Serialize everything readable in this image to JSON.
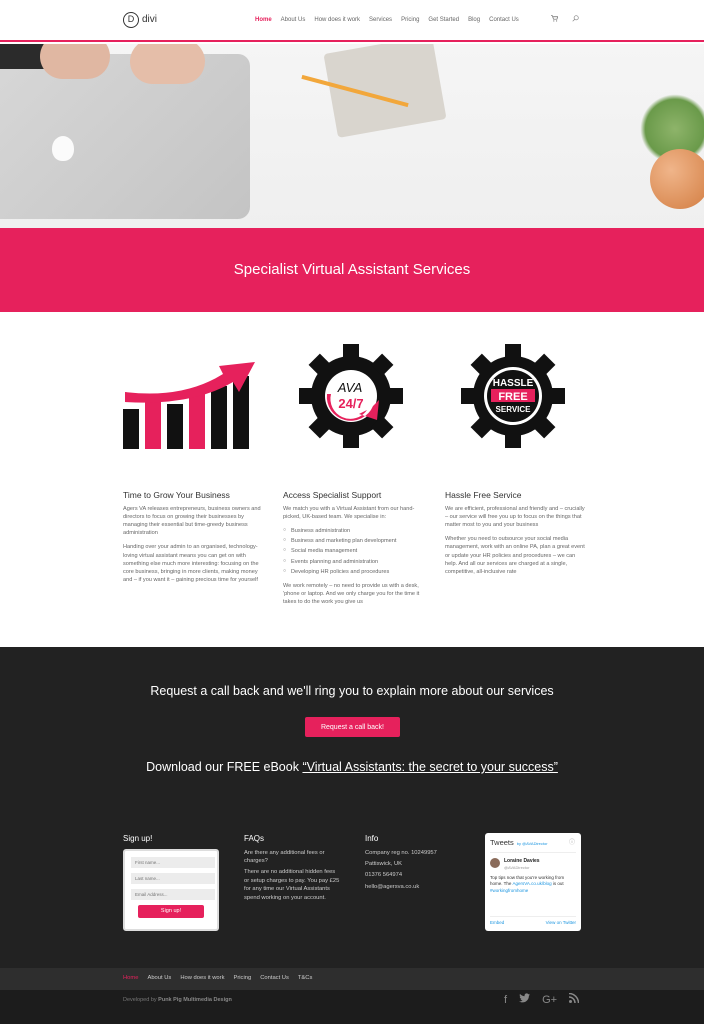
{
  "header": {
    "logo_letter": "D",
    "logo_text": "divi",
    "nav": [
      "Home",
      "About Us",
      "How does it work",
      "Services",
      "Pricing",
      "Get Started",
      "Blog",
      "Contact Us"
    ],
    "cart_icon": "cart-icon",
    "search_icon": "search-icon"
  },
  "band": {
    "title": "Specialist Virtual Assistant Services"
  },
  "features": {
    "f1": {
      "title": "Time to Grow Your Business",
      "p1": "Agers VA releases entrepreneurs, business owners and directors to focus on growing their businesses by managing their essential but time-greedy business administration",
      "p2": "Handing over your admin to an organised, technology-loving virtual assistant means you can get on with something else much more interesting: focusing on the core business, bringing in more clients, making money and – if you want it – gaining precious time for yourself"
    },
    "f2": {
      "title": "Access Specialist Support",
      "p1": "We match you with a Virtual Assistant from our hand-picked, UK-based team. We specialise in:",
      "list": [
        "Business administration",
        "Business and marketing plan development",
        "Social media management",
        "Events planning and administration",
        "Developing HR policies and procedures"
      ],
      "p2": "We work remotely – no need to provide us with a desk, 'phone or laptop. And we only charge you for the time it takes to do the work you give us",
      "badge_top": "AVA",
      "badge_bottom": "24/7"
    },
    "f3": {
      "title": "Hassle Free Service",
      "p1": "We are efficient, professional and friendly and – crucially – our service will free you up to focus on the things that matter most to you and your business",
      "p2": "Whether you need to outsource your social media management, work with an online PA, plan a great event or update your HR policies and procedures – we can help. And all our services are charged at a single, competitive, all-inclusive rate",
      "badge": [
        "HASSLE",
        "FREE",
        "SERVICE"
      ]
    }
  },
  "cta": {
    "line1": "Request a call back and we'll ring you to explain more about our services",
    "button": "Request a call back!",
    "line2_prefix": "Download our FREE eBook ",
    "line2_link": "“Virtual Assistants: the secret to your success”"
  },
  "signup": {
    "title": "Sign up!",
    "first": "First name...",
    "last": "Last name...",
    "email": "Email Address...",
    "button": "Sign up!"
  },
  "faq": {
    "title": "FAQs",
    "q": "Are there any additional fees or charges?",
    "a": "There are no additional hidden fees or setup charges to pay. You pay £25 for any time our Virtual Assistants spend working on your account."
  },
  "info": {
    "title": "Info",
    "lines": [
      "Company reg no. 10249957",
      "Pattiswick, UK",
      "01376 564974",
      "hello@agersva.co.uk"
    ]
  },
  "twitter": {
    "title": "Tweets",
    "by": "by @AVADirector",
    "name": "Loraine Davies",
    "handle": "@AVADirector",
    "text_a": "Top tips now that you're working from home. The ",
    "text_link": "AgersVA.co.uk/blog",
    "text_b": " is out ",
    "hashtag": "#workingfromhome",
    "embed": "Embed",
    "view": "View on Twitter"
  },
  "footer_nav": [
    "Home",
    "About Us",
    "How does it work",
    "Pricing",
    "Contact Us",
    "T&Cs"
  ],
  "credit": {
    "prefix": "Developed by ",
    "name": "Punk Pig Multimedia Design"
  },
  "social": [
    "f",
    "🐦",
    "G+",
    "⦿"
  ]
}
